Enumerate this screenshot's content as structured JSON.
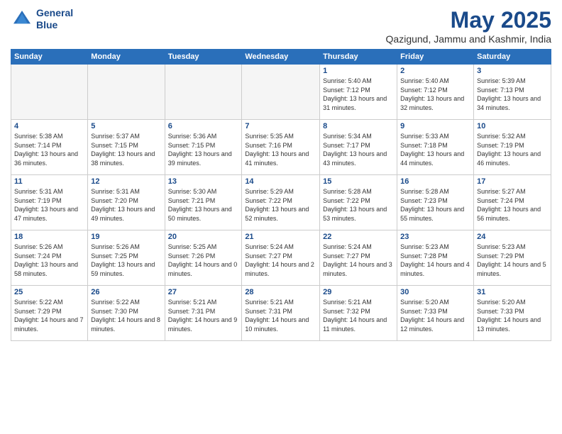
{
  "header": {
    "logo_line1": "General",
    "logo_line2": "Blue",
    "month": "May 2025",
    "location": "Qazigund, Jammu and Kashmir, India"
  },
  "weekdays": [
    "Sunday",
    "Monday",
    "Tuesday",
    "Wednesday",
    "Thursday",
    "Friday",
    "Saturday"
  ],
  "weeks": [
    [
      {
        "day": "",
        "info": ""
      },
      {
        "day": "",
        "info": ""
      },
      {
        "day": "",
        "info": ""
      },
      {
        "day": "",
        "info": ""
      },
      {
        "day": "1",
        "info": "Sunrise: 5:40 AM\nSunset: 7:12 PM\nDaylight: 13 hours\nand 31 minutes."
      },
      {
        "day": "2",
        "info": "Sunrise: 5:40 AM\nSunset: 7:12 PM\nDaylight: 13 hours\nand 32 minutes."
      },
      {
        "day": "3",
        "info": "Sunrise: 5:39 AM\nSunset: 7:13 PM\nDaylight: 13 hours\nand 34 minutes."
      }
    ],
    [
      {
        "day": "4",
        "info": "Sunrise: 5:38 AM\nSunset: 7:14 PM\nDaylight: 13 hours\nand 36 minutes."
      },
      {
        "day": "5",
        "info": "Sunrise: 5:37 AM\nSunset: 7:15 PM\nDaylight: 13 hours\nand 38 minutes."
      },
      {
        "day": "6",
        "info": "Sunrise: 5:36 AM\nSunset: 7:15 PM\nDaylight: 13 hours\nand 39 minutes."
      },
      {
        "day": "7",
        "info": "Sunrise: 5:35 AM\nSunset: 7:16 PM\nDaylight: 13 hours\nand 41 minutes."
      },
      {
        "day": "8",
        "info": "Sunrise: 5:34 AM\nSunset: 7:17 PM\nDaylight: 13 hours\nand 43 minutes."
      },
      {
        "day": "9",
        "info": "Sunrise: 5:33 AM\nSunset: 7:18 PM\nDaylight: 13 hours\nand 44 minutes."
      },
      {
        "day": "10",
        "info": "Sunrise: 5:32 AM\nSunset: 7:19 PM\nDaylight: 13 hours\nand 46 minutes."
      }
    ],
    [
      {
        "day": "11",
        "info": "Sunrise: 5:31 AM\nSunset: 7:19 PM\nDaylight: 13 hours\nand 47 minutes."
      },
      {
        "day": "12",
        "info": "Sunrise: 5:31 AM\nSunset: 7:20 PM\nDaylight: 13 hours\nand 49 minutes."
      },
      {
        "day": "13",
        "info": "Sunrise: 5:30 AM\nSunset: 7:21 PM\nDaylight: 13 hours\nand 50 minutes."
      },
      {
        "day": "14",
        "info": "Sunrise: 5:29 AM\nSunset: 7:22 PM\nDaylight: 13 hours\nand 52 minutes."
      },
      {
        "day": "15",
        "info": "Sunrise: 5:28 AM\nSunset: 7:22 PM\nDaylight: 13 hours\nand 53 minutes."
      },
      {
        "day": "16",
        "info": "Sunrise: 5:28 AM\nSunset: 7:23 PM\nDaylight: 13 hours\nand 55 minutes."
      },
      {
        "day": "17",
        "info": "Sunrise: 5:27 AM\nSunset: 7:24 PM\nDaylight: 13 hours\nand 56 minutes."
      }
    ],
    [
      {
        "day": "18",
        "info": "Sunrise: 5:26 AM\nSunset: 7:24 PM\nDaylight: 13 hours\nand 58 minutes."
      },
      {
        "day": "19",
        "info": "Sunrise: 5:26 AM\nSunset: 7:25 PM\nDaylight: 13 hours\nand 59 minutes."
      },
      {
        "day": "20",
        "info": "Sunrise: 5:25 AM\nSunset: 7:26 PM\nDaylight: 14 hours\nand 0 minutes."
      },
      {
        "day": "21",
        "info": "Sunrise: 5:24 AM\nSunset: 7:27 PM\nDaylight: 14 hours\nand 2 minutes."
      },
      {
        "day": "22",
        "info": "Sunrise: 5:24 AM\nSunset: 7:27 PM\nDaylight: 14 hours\nand 3 minutes."
      },
      {
        "day": "23",
        "info": "Sunrise: 5:23 AM\nSunset: 7:28 PM\nDaylight: 14 hours\nand 4 minutes."
      },
      {
        "day": "24",
        "info": "Sunrise: 5:23 AM\nSunset: 7:29 PM\nDaylight: 14 hours\nand 5 minutes."
      }
    ],
    [
      {
        "day": "25",
        "info": "Sunrise: 5:22 AM\nSunset: 7:29 PM\nDaylight: 14 hours\nand 7 minutes."
      },
      {
        "day": "26",
        "info": "Sunrise: 5:22 AM\nSunset: 7:30 PM\nDaylight: 14 hours\nand 8 minutes."
      },
      {
        "day": "27",
        "info": "Sunrise: 5:21 AM\nSunset: 7:31 PM\nDaylight: 14 hours\nand 9 minutes."
      },
      {
        "day": "28",
        "info": "Sunrise: 5:21 AM\nSunset: 7:31 PM\nDaylight: 14 hours\nand 10 minutes."
      },
      {
        "day": "29",
        "info": "Sunrise: 5:21 AM\nSunset: 7:32 PM\nDaylight: 14 hours\nand 11 minutes."
      },
      {
        "day": "30",
        "info": "Sunrise: 5:20 AM\nSunset: 7:33 PM\nDaylight: 14 hours\nand 12 minutes."
      },
      {
        "day": "31",
        "info": "Sunrise: 5:20 AM\nSunset: 7:33 PM\nDaylight: 14 hours\nand 13 minutes."
      }
    ]
  ]
}
